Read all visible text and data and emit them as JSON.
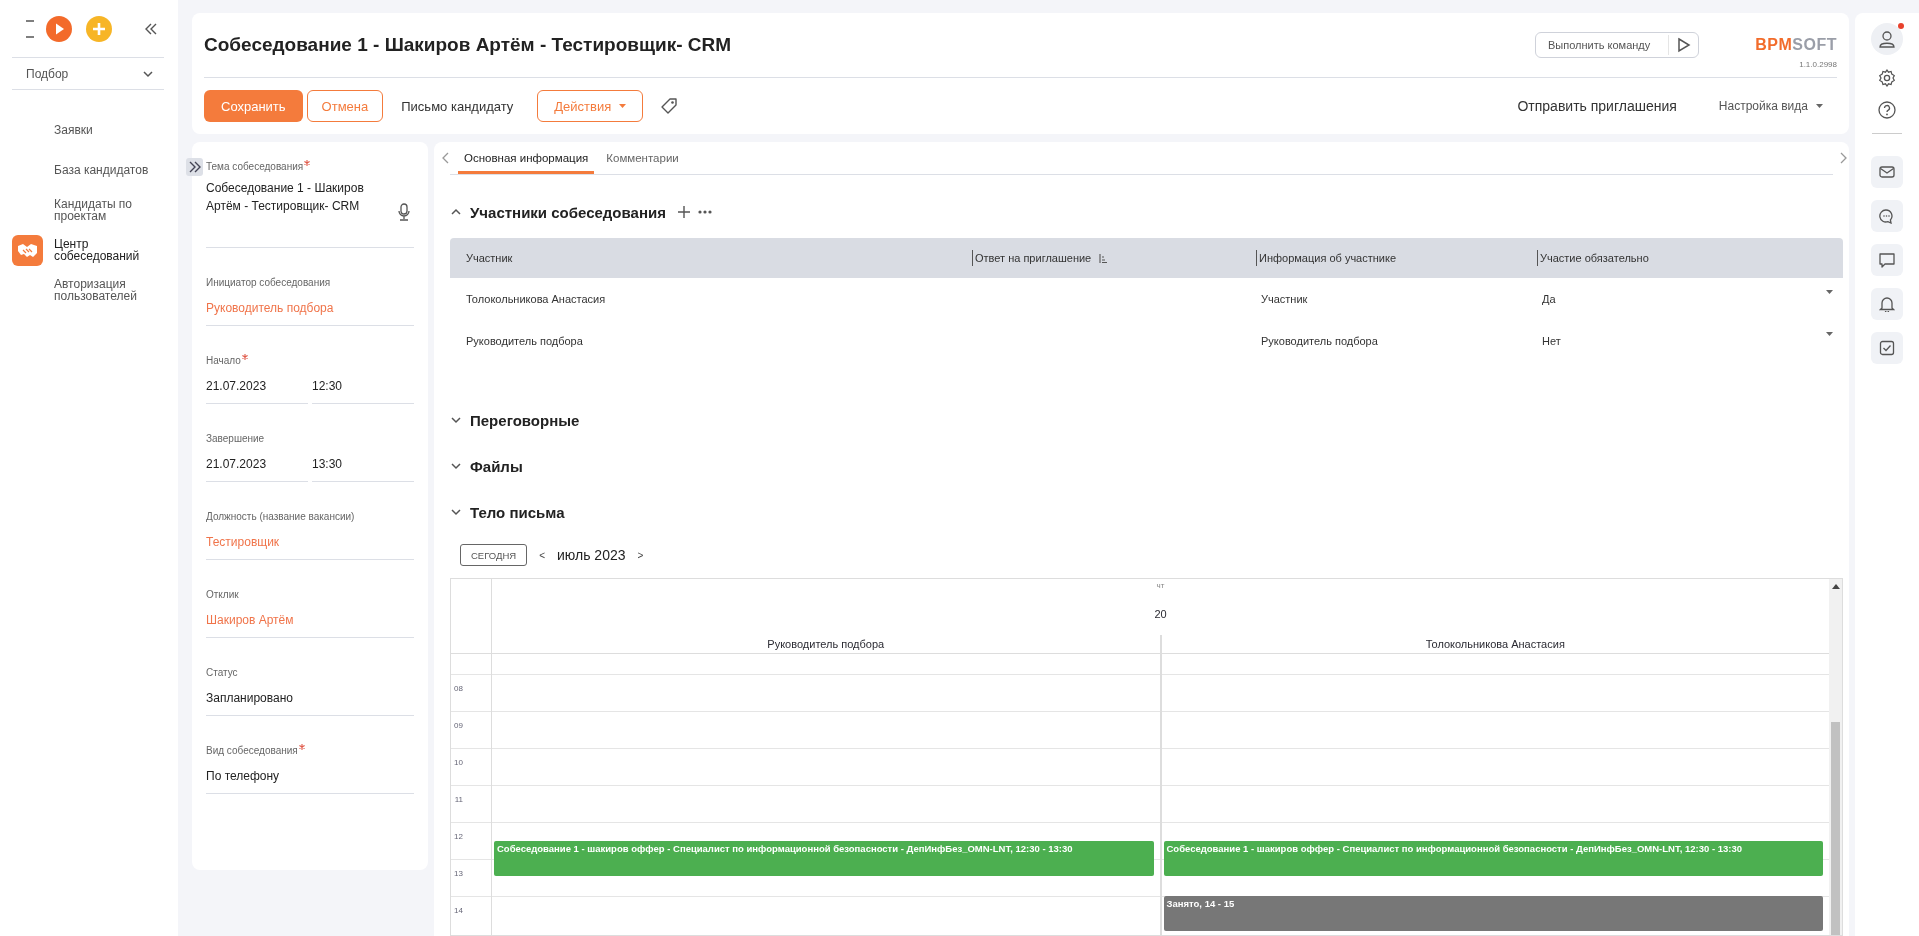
{
  "app_bar": {
    "section": "Подбор"
  },
  "nav": {
    "items": [
      {
        "label": "Заявки",
        "selected": false
      },
      {
        "label": "База кандидатов",
        "selected": false
      },
      {
        "label": "Кандидаты по проектам",
        "selected": false
      },
      {
        "label": "Центр собеседований",
        "selected": true
      },
      {
        "label": "Авторизация пользователей",
        "selected": false
      }
    ]
  },
  "page": {
    "title": "Собеседование 1 - Шакиров Артём - Тестировщик- CRM",
    "command_placeholder": "Выполнить команду",
    "logo": {
      "part_1": "BPM",
      "part_2": "SOFT"
    },
    "version": "1.1.0.2998"
  },
  "toolbar": {
    "save": "Сохранить",
    "cancel": "Отмена",
    "letter": "Письмо кандидату",
    "actions": "Действия",
    "send_invites": "Отправить приглашения",
    "view_settings": "Настройка вида"
  },
  "user": {
    "has_notification": true
  },
  "form": {
    "fields": [
      {
        "kind": "memo",
        "label": "Тема собеседования",
        "required": true,
        "value": "Собеседование 1 - Шакиров Артём - Тестировщик- CRM"
      },
      {
        "kind": "link",
        "label": "Инициатор собеседования",
        "required": false,
        "value": "Руководитель подбора"
      },
      {
        "kind": "datetime",
        "label": "Начало",
        "required": true,
        "date": "21.07.2023",
        "time": "12:30"
      },
      {
        "kind": "datetime",
        "label": "Завершение",
        "required": false,
        "date": "21.07.2023",
        "time": "13:30"
      },
      {
        "kind": "link",
        "label": "Должность (название вакансии)",
        "required": false,
        "value": "Тестировщик"
      },
      {
        "kind": "link",
        "label": "Отклик",
        "required": false,
        "value": "Шакиров Артём"
      },
      {
        "kind": "text",
        "label": "Статус",
        "required": false,
        "value": "Запланировано"
      },
      {
        "kind": "text",
        "label": "Вид собеседования",
        "required": true,
        "value": "По телефону"
      }
    ]
  },
  "tabs": [
    {
      "label": "Основная информация",
      "selected": true
    },
    {
      "label": "Комментарии",
      "selected": false
    }
  ],
  "participants": {
    "title": "Участники собеседования",
    "expanded": true,
    "columns": [
      {
        "label": "Участник",
        "sorted": false
      },
      {
        "label": "Ответ на приглашение",
        "sorted": true
      },
      {
        "label": "Информация об участнике",
        "sorted": false
      },
      {
        "label": "Участие обязательно",
        "sorted": false
      }
    ],
    "rows": [
      {
        "participant": "Толокольникова Анастасия",
        "info": "Участник",
        "required": "Да"
      },
      {
        "participant": "Руководитель подбора",
        "info": "Руководитель подбора",
        "required": "Нет"
      }
    ]
  },
  "sections": [
    {
      "title": "Переговорные",
      "expanded": false
    },
    {
      "title": "Файлы",
      "expanded": false
    },
    {
      "title": "Тело письма",
      "expanded": false
    }
  ],
  "calendar": {
    "today": "СЕГОДНЯ",
    "prev": "<",
    "month": "июль 2023",
    "next": ">",
    "weekday": "чт",
    "day": "20",
    "hours": [
      "08",
      "09",
      "10",
      "11",
      "12",
      "13",
      "14"
    ],
    "resources": [
      {
        "name": "Руководитель подбора",
        "events": [
          {
            "title": "Собеседование 1 - шакиров оффер - Специалист по информационной безопасности - ДепИнфБез_OMN-LNT,",
            "start": "12:30",
            "separator": "-",
            "end": "13:30",
            "color": "#4caf50"
          }
        ]
      },
      {
        "name": "Толокольникова Анастасия",
        "events": [
          {
            "title": "Собеседование 1 - шакиров оффер - Специалист по информационной безопасности - ДепИнфБез_OMN-LNT,",
            "start": "12:30",
            "separator": "-",
            "end": "13:30",
            "color": "#4caf50"
          },
          {
            "title": "Занято,",
            "start": "14",
            "separator": "-",
            "end": "15",
            "color": "#777777"
          }
        ]
      }
    ]
  }
}
